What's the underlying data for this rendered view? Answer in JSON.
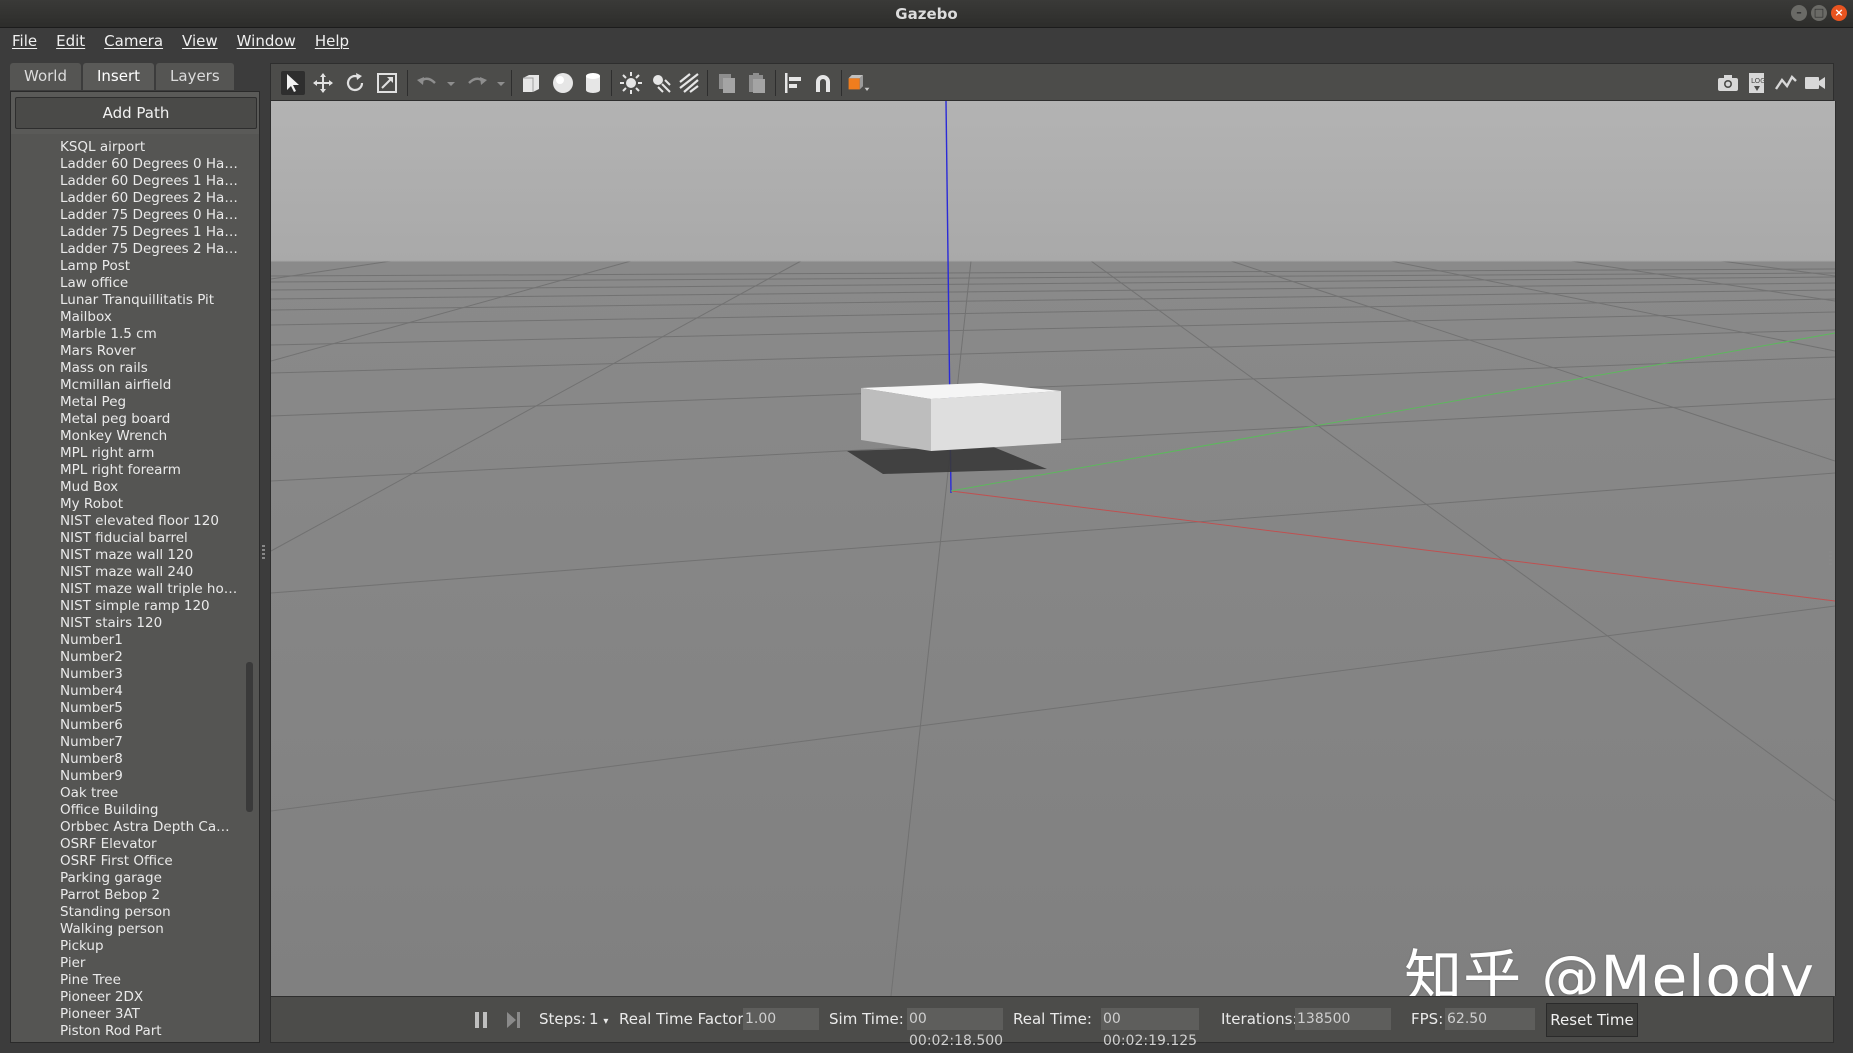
{
  "window": {
    "title": "Gazebo"
  },
  "menu": [
    "File",
    "Edit",
    "Camera",
    "View",
    "Window",
    "Help"
  ],
  "left_panel": {
    "tabs": [
      {
        "label": "World",
        "active": false
      },
      {
        "label": "Insert",
        "active": true
      },
      {
        "label": "Layers",
        "active": false
      }
    ],
    "add_path_label": "Add Path",
    "models": [
      "KSQL airport",
      "Ladder 60 Degrees 0 Ha…",
      "Ladder 60 Degrees 1 Ha…",
      "Ladder 60 Degrees 2 Ha…",
      "Ladder 75 Degrees 0 Ha…",
      "Ladder 75 Degrees 1 Ha…",
      "Ladder 75 Degrees 2 Ha…",
      "Lamp Post",
      "Law office",
      "Lunar Tranquillitatis Pit",
      "Mailbox",
      "Marble 1.5 cm",
      "Mars Rover",
      "Mass on rails",
      "Mcmillan airfield",
      "Metal Peg",
      "Metal peg board",
      "Monkey Wrench",
      "MPL right arm",
      "MPL right forearm",
      "Mud Box",
      "My Robot",
      "NIST elevated floor 120",
      "NIST fiducial barrel",
      "NIST maze wall 120",
      "NIST maze wall 240",
      "NIST maze wall triple ho…",
      "NIST simple ramp 120",
      "NIST stairs 120",
      "Number1",
      "Number2",
      "Number3",
      "Number4",
      "Number5",
      "Number6",
      "Number7",
      "Number8",
      "Number9",
      "Oak tree",
      "Office Building",
      "Orbbec Astra Depth Ca…",
      "OSRF Elevator",
      "OSRF First Office",
      "Parking garage",
      "Parrot Bebop 2",
      "Standing person",
      "Walking person",
      "Pickup",
      "Pier",
      "Pine Tree",
      "Pioneer 2DX",
      "Pioneer 3AT",
      "Piston Rod Part"
    ]
  },
  "toolbar": {
    "left_icons": [
      "select-arrow-icon",
      "translate-icon",
      "rotate-icon",
      "scale-icon",
      "undo-icon",
      "undo-dropdown-icon",
      "redo-icon",
      "redo-dropdown-icon",
      "box-shape-icon",
      "sphere-shape-icon",
      "cylinder-shape-icon",
      "point-light-icon",
      "spot-light-icon",
      "directional-light-icon",
      "copy-icon",
      "paste-icon",
      "align-icon",
      "snap-icon",
      "view-angle-icon"
    ],
    "right_icons": [
      "screenshot-icon",
      "log-icon",
      "plot-icon",
      "record-video-icon"
    ],
    "accent_color": "#f07d1e"
  },
  "status": {
    "steps_label": "Steps:",
    "steps_value": "1",
    "rtf_label": "Real Time Factor:",
    "rtf_value": "1.00",
    "sim_time_label": "Sim Time:",
    "sim_time_value": "00 00:02:18.500",
    "real_time_label": "Real Time:",
    "real_time_value": "00 00:02:19.125",
    "iterations_label": "Iterations:",
    "iterations_value": "138500",
    "fps_label": "FPS:",
    "fps_value": "62.50",
    "reset_label": "Reset Time"
  },
  "watermark": "知乎 @Melody"
}
